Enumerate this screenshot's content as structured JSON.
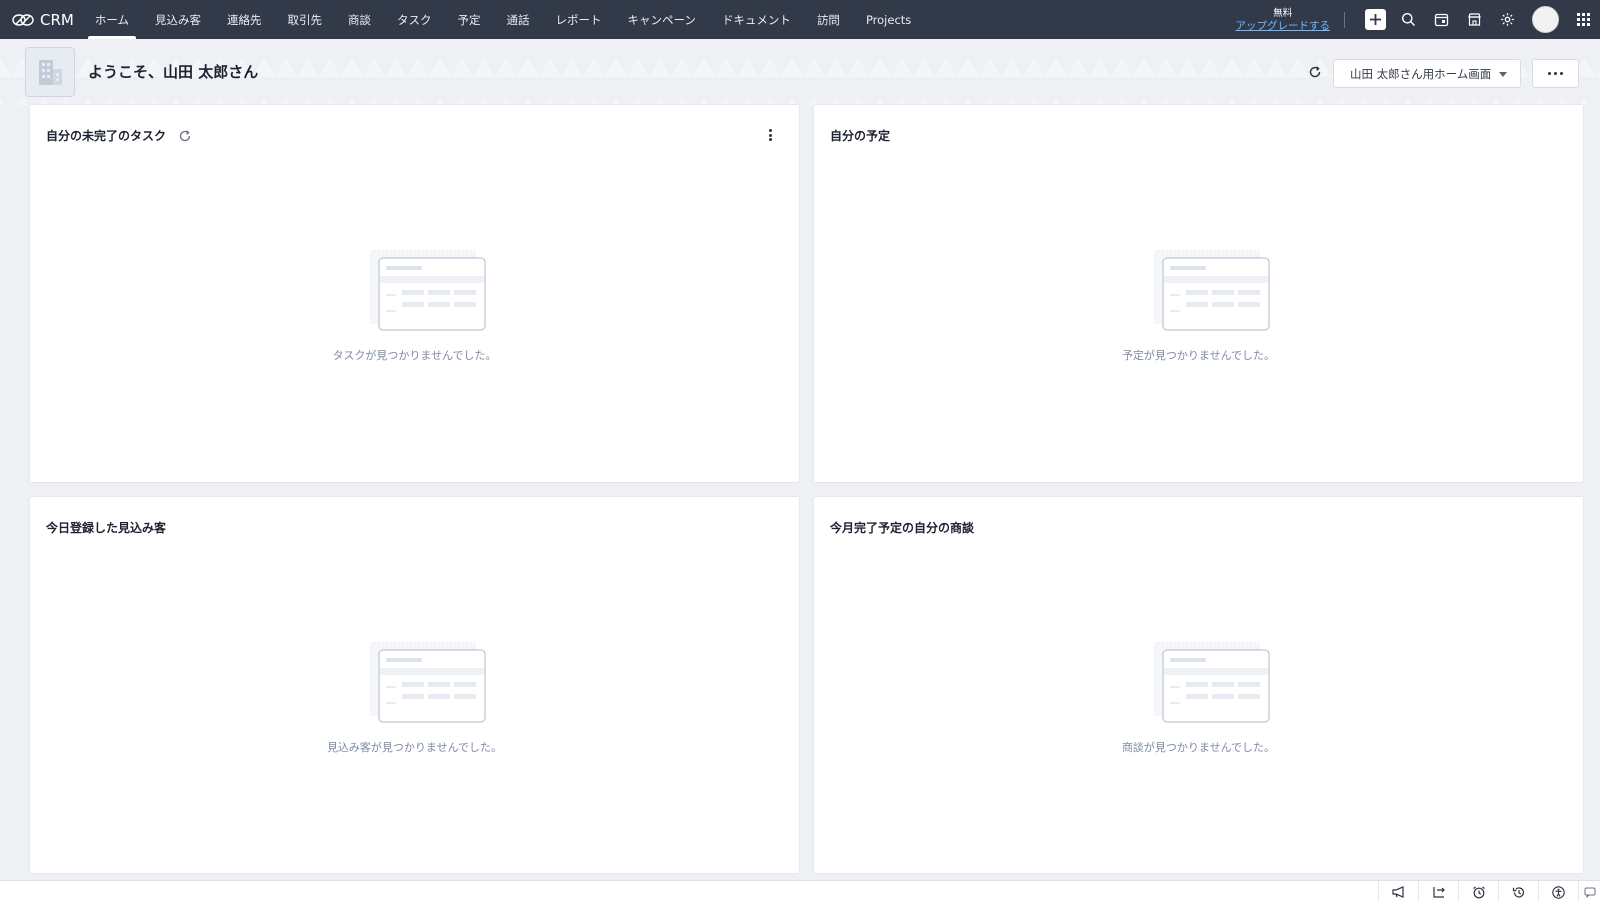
{
  "app": {
    "brand": "CRM"
  },
  "nav": {
    "items": [
      {
        "label": "ホーム",
        "active": true
      },
      {
        "label": "見込み客"
      },
      {
        "label": "連絡先"
      },
      {
        "label": "取引先"
      },
      {
        "label": "商談"
      },
      {
        "label": "タスク"
      },
      {
        "label": "予定"
      },
      {
        "label": "通話"
      },
      {
        "label": "レポート"
      },
      {
        "label": "キャンペーン"
      },
      {
        "label": "ドキュメント"
      },
      {
        "label": "訪問"
      },
      {
        "label": "Projects"
      }
    ]
  },
  "upgrade": {
    "plan": "無料",
    "link": "アップグレードする"
  },
  "toolbar_icons": [
    "plus-icon",
    "search-icon",
    "calendar-icon",
    "store-icon",
    "gear-icon",
    "avatar",
    "apps-grid-icon"
  ],
  "header": {
    "welcome": "ようこそ、山田 太郎さん",
    "layout_select": "山田 太郎さん用ホーム画面"
  },
  "cards": [
    {
      "title": "自分の未完了のタスク",
      "empty": "タスクが見つかりませんでした。"
    },
    {
      "title": "自分の予定",
      "empty": "予定が見つかりませんでした。"
    },
    {
      "title": "今日登録した見込み客",
      "empty": "見込み客が見つかりませんでした。"
    },
    {
      "title": "今月完了予定の自分の商談",
      "empty": "商談が見つかりませんでした。"
    }
  ],
  "footer_icons": [
    "megaphone-icon",
    "sync-icon",
    "alarm-icon",
    "history-icon",
    "accessibility-icon",
    "chat-icon"
  ],
  "colors": {
    "topbar": "#323a4a",
    "background": "#eef0f4",
    "link": "#6db8ff",
    "empty_text": "#7f8aa3"
  }
}
